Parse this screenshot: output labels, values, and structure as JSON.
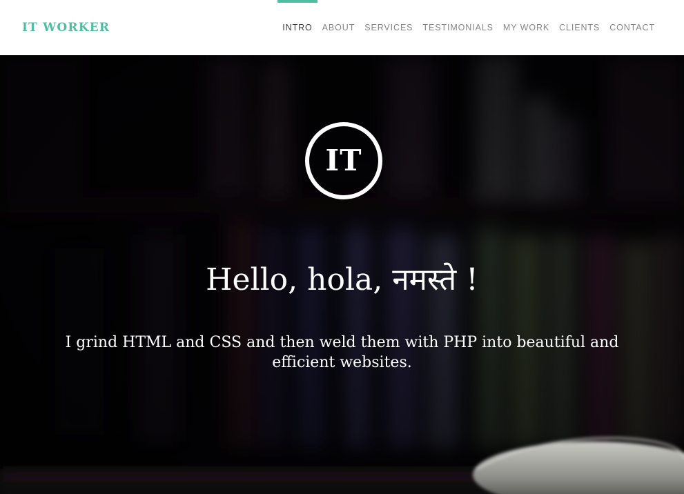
{
  "header": {
    "brand": "IT WORKER",
    "nav": [
      {
        "label": "INTRO",
        "active": true
      },
      {
        "label": "ABOUT",
        "active": false
      },
      {
        "label": "SERVICES",
        "active": false
      },
      {
        "label": "TESTIMONIALS",
        "active": false
      },
      {
        "label": "MY WORK",
        "active": false
      },
      {
        "label": "CLIENTS",
        "active": false
      },
      {
        "label": "CONTACT",
        "active": false
      }
    ]
  },
  "hero": {
    "logo_text": "IT",
    "headline": "Hello, hola, नमस्ते !",
    "tagline": "I grind HTML and CSS and then weld them with PHP into beautiful and efficient websites."
  },
  "colors": {
    "accent": "#4dbfa0",
    "header_bg": "#ffffff",
    "nav_text": "#858585",
    "nav_active_text": "#3a3a3a",
    "hero_text": "#ffffff"
  },
  "icons": {
    "background_image": "blurred-bookshelf-with-computer-mouse"
  }
}
